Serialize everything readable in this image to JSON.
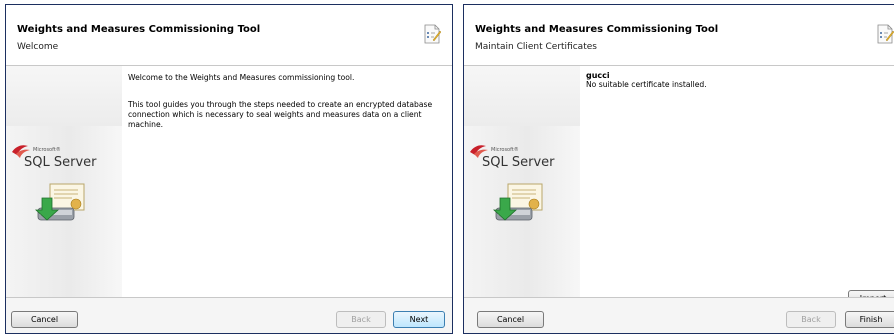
{
  "windows": [
    {
      "title": "Weights and Measures Commissioning Tool",
      "subtitle": "Welcome",
      "body": {
        "p1": "Welcome to the Weights and Measures commissioning tool.",
        "p2": "This tool guides you through the steps needed to create an encrypted database connection which is necessary to seal weights and measures data on a client machine."
      },
      "buttons": {
        "cancel": "Cancel",
        "back": "Back",
        "next": "Next"
      }
    },
    {
      "title": "Weights and Measures Commissioning Tool",
      "subtitle": "Maintain Client Certificates",
      "cert_name": "gucci",
      "cert_status": "No suitable certificate installed.",
      "buttons": {
        "cancel": "Cancel",
        "back": "Back",
        "finish": "Finish",
        "import": "Import"
      }
    }
  ],
  "brand": {
    "microsoft": "Microsoft®",
    "sql": "SQL Server"
  }
}
